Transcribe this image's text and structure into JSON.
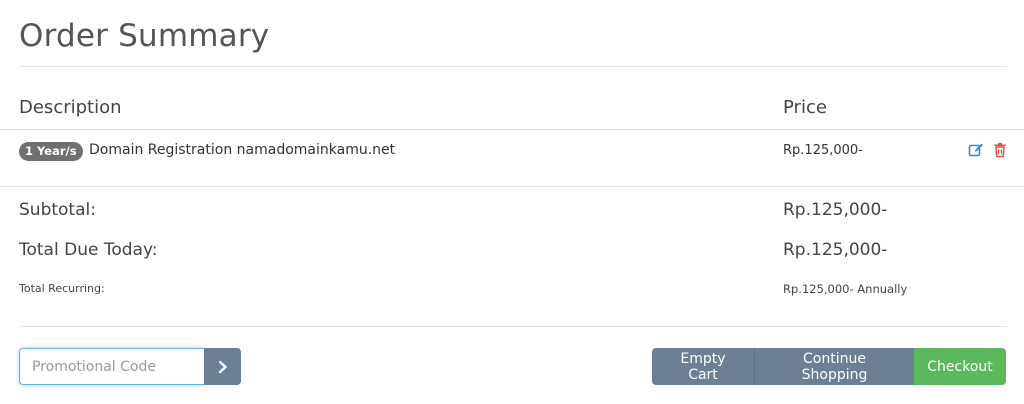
{
  "page": {
    "title": "Order Summary"
  },
  "table": {
    "headers": {
      "description": "Description",
      "price": "Price"
    },
    "items": [
      {
        "badge": "1 Year/s",
        "description": "Domain Registration namadomainkamu.net",
        "price": "Rp.125,000-"
      }
    ]
  },
  "totals": {
    "subtotal_label": "Subtotal:",
    "subtotal_value": "Rp.125,000-",
    "due_label": "Total Due Today:",
    "due_value": "Rp.125,000-",
    "recurring_label": "Total Recurring:",
    "recurring_value": "Rp.125,000- Annually"
  },
  "promo": {
    "placeholder": "Promotional Code",
    "value": ""
  },
  "actions": {
    "empty_cart": "Empty Cart",
    "continue_shopping": "Continue Shopping",
    "checkout": "Checkout"
  },
  "icons": {
    "edit": "edit-icon",
    "delete": "trash-icon",
    "submit": "chevron-right-icon"
  },
  "colors": {
    "primary_button": "#6c7f93",
    "checkout_button": "#5cb85c",
    "edit_icon": "#3a87c8",
    "delete_icon": "#d9534f",
    "badge": "#707070"
  }
}
